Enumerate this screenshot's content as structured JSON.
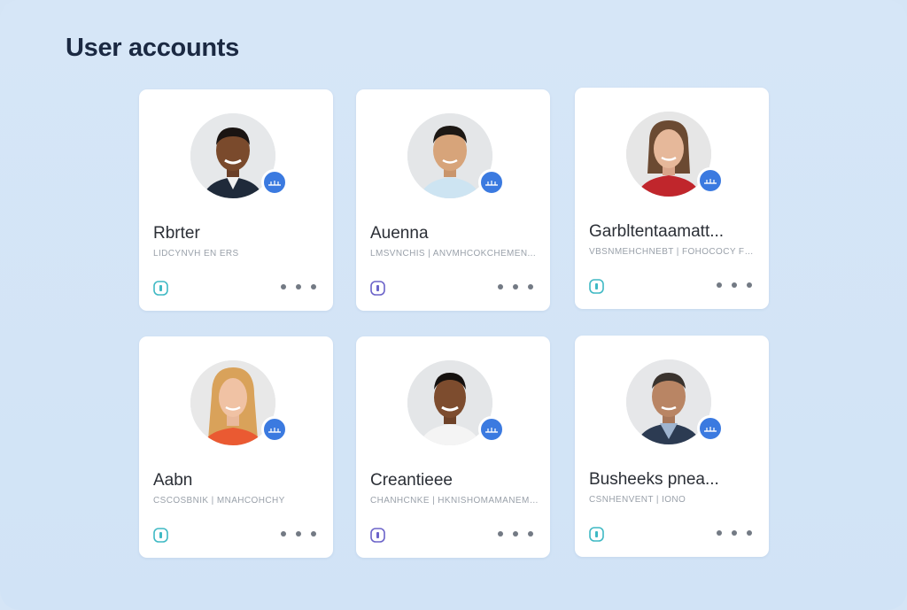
{
  "page": {
    "title": "User accounts"
  },
  "users": [
    {
      "name": "Rbrter",
      "subtitle": "LIDCYNVH EN ERS",
      "status_icon": "lock-icon",
      "accent": "#3fb9c4"
    },
    {
      "name": "Auenna",
      "subtitle": "LMSVNCHIS | ANVMHCOKCHEMEN...",
      "status_icon": "lock-icon",
      "accent": "#6b63c9"
    },
    {
      "name": "Garbltentaamatt...",
      "subtitle": "VBSNMEHCHNEBT | FOHOCOCY FOHO...",
      "status_icon": "lock-icon",
      "accent": "#3fb9c4"
    },
    {
      "name": "Aabn",
      "subtitle": "CSCOSBNIK | MNAHCOHCHY",
      "status_icon": "lock-icon",
      "accent": "#3fb9c4"
    },
    {
      "name": "Creantieee",
      "subtitle": "CHANHCNKE | HKNISHOMAMANEMI...",
      "status_icon": "lock-icon",
      "accent": "#6b63c9"
    },
    {
      "name": "Busheeks pnea...",
      "subtitle": "CSNHENVENT | IONO",
      "status_icon": "lock-icon",
      "accent": "#3fb9c4"
    }
  ],
  "colors": {
    "background": "#d5e5f6",
    "card": "#ffffff",
    "badge": "#3b7ae0",
    "title": "#1b2942"
  },
  "icons": {
    "badge": "verified-cloud-icon",
    "more": "more-dots-icon"
  }
}
